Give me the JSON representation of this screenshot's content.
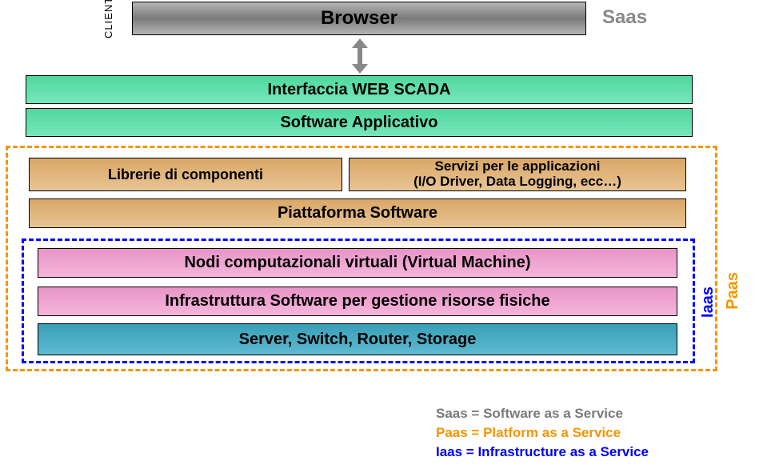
{
  "clientLabel": "CLIENT",
  "browser": "Browser",
  "saasLabel": "Saas",
  "webScada": "Interfaccia WEB SCADA",
  "softwareApp": "Software Applicativo",
  "librerie": "Librerie di componenti",
  "serviziLine1": "Servizi per le applicazioni",
  "serviziLine2": "(I/O Driver, Data Logging, ecc…)",
  "piattaforma": "Piattaforma Software",
  "nodi": "Nodi computazionali virtuali (Virtual Machine)",
  "infra": "Infrastruttura Software per gestione risorse fisiche",
  "server": "Server, Switch, Router, Storage",
  "paasLabel": "Paas",
  "iaasLabel": "Iaas",
  "legend": {
    "saas": "Saas = Software as a Service",
    "paas": "Paas = Platform as a Service",
    "iaas": "Iaas  = Infrastructure as a Service"
  }
}
